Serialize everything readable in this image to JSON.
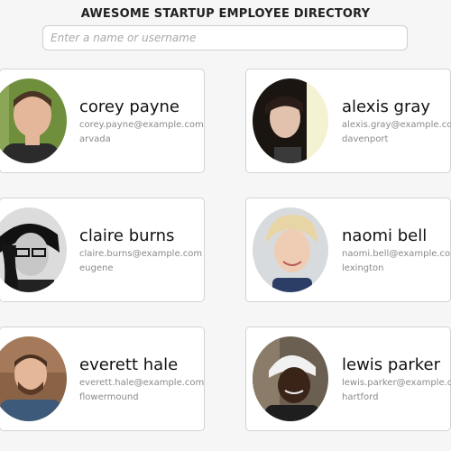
{
  "header": {
    "title": "AWESOME STARTUP EMPLOYEE DIRECTORY"
  },
  "search": {
    "placeholder": "Enter a name or username",
    "value": ""
  },
  "employees": [
    {
      "name": "corey payne",
      "email": "corey.payne@example.com",
      "city": "arvada"
    },
    {
      "name": "alexis gray",
      "email": "alexis.gray@example.com",
      "city": "davenport"
    },
    {
      "name": "claire burns",
      "email": "claire.burns@example.com",
      "city": "eugene"
    },
    {
      "name": "naomi bell",
      "email": "naomi.bell@example.com",
      "city": "lexington"
    },
    {
      "name": "everett hale",
      "email": "everett.hale@example.com",
      "city": "flowermound"
    },
    {
      "name": "lewis parker",
      "email": "lewis.parker@example.com",
      "city": "hartford"
    }
  ]
}
